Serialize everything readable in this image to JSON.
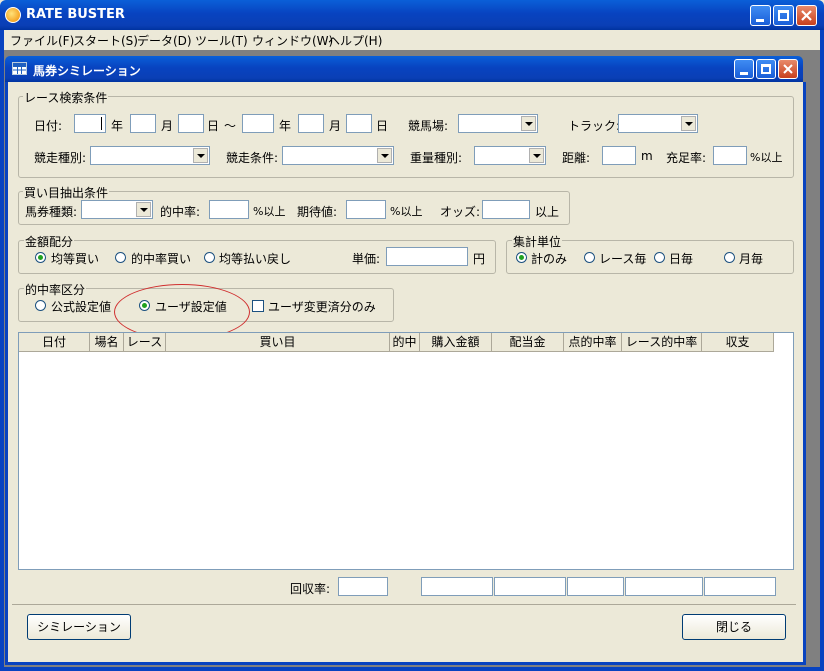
{
  "app": {
    "title": "RATE BUSTER"
  },
  "menu": [
    "ファイル(F)",
    "スタート(S)",
    "データ(D)",
    "ツール(T)",
    "ウィンドウ(W)",
    "ヘルプ(H)"
  ],
  "child_window": {
    "title": "馬券シミレーション"
  },
  "race_search": {
    "legend": "レース検索条件",
    "date_label": "日付:",
    "year": "年",
    "month": "月",
    "day": "日",
    "tilde": "～",
    "venue_label": "競馬場:",
    "track_label": "トラック:",
    "race_type_label": "競走種別:",
    "race_cond_label": "競走条件:",
    "weight_type_label": "重量種別:",
    "distance_label": "距離:",
    "distance_unit": "m",
    "fill_rate_label": "充足率:",
    "fill_rate_unit": "%以上"
  },
  "extract": {
    "legend": "買い目抽出条件",
    "bet_type_label": "馬券種類:",
    "hit_rate_label": "的中率:",
    "hit_rate_unit": "%以上",
    "expect_label": "期待値:",
    "expect_unit": "%以上",
    "odds_label": "オッズ:",
    "odds_unit": "以上"
  },
  "allocation": {
    "legend": "金額配分",
    "options": [
      "均等買い",
      "的中率買い",
      "均等払い戻し"
    ],
    "selected": 0,
    "unit_price_label": "単価:",
    "unit_price_suffix": "円"
  },
  "aggregate": {
    "legend": "集計単位",
    "options": [
      "計のみ",
      "レース毎",
      "日毎",
      "月毎"
    ],
    "selected": 0
  },
  "hit_rate_class": {
    "legend": "的中率区分",
    "options": [
      "公式設定値",
      "ユーザ設定値"
    ],
    "selected": 1,
    "checkbox_label": "ユーザ変更済分のみ"
  },
  "table": {
    "columns": [
      "日付",
      "場名",
      "レース",
      "買い目",
      "的中",
      "購入金額",
      "配当金",
      "点的中率",
      "レース的中率",
      "収支"
    ]
  },
  "summary": {
    "recovery_label": "回収率:"
  },
  "buttons": {
    "simulate": "シミレーション",
    "close": "閉じる"
  },
  "colors": {
    "title_bar": "#0843c0",
    "annotation_ellipse": "#d03030",
    "window_bg": "#ece9d8"
  }
}
